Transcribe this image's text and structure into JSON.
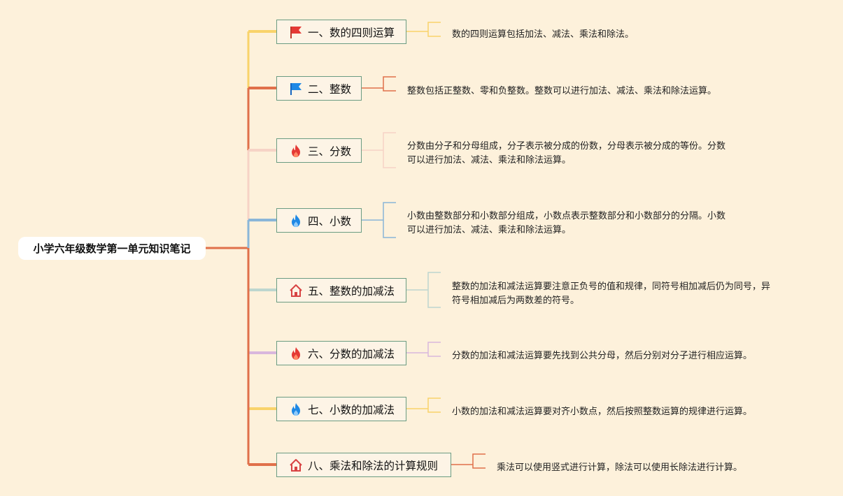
{
  "root": {
    "title": "小学六年级数学第一单元知识笔记"
  },
  "topics": [
    {
      "label": "一、数的四则运算",
      "icon": "red-flag-icon",
      "color": "#f9d36a",
      "note": [
        "数的四则运算包括加法、减法、乘法和除法。"
      ]
    },
    {
      "label": "二、整数",
      "icon": "blue-flag-icon",
      "color": "#e0704a",
      "note": [
        "整数包括正整数、零和负整数。整数可以进行加法、减法、乘法和除法运算。"
      ]
    },
    {
      "label": "三、分数",
      "icon": "fire-icon",
      "color": "#f6d3c6",
      "note": [
        "分数由分子和分母组成，分子表示被分成的份数，分母表示被分成的等份。分数",
        "可以进行加法、减法、乘法和除法运算。"
      ]
    },
    {
      "label": "四、小数",
      "icon": "blue-fire-icon",
      "color": "#8ab6d8",
      "note": [
        "小数由整数部分和小数部分组成，小数点表示整数部分和小数部分的分隔。小数",
        "可以进行加法、减法、乘法和除法运算。"
      ]
    },
    {
      "label": "五、整数的加减法",
      "icon": "house-icon",
      "color": "#bdd6cf",
      "note": [
        "整数的加法和减法运算要注意正负号的值和规律，同符号相加减后仍为同号，异",
        "符号相加减后为两数差的符号。"
      ]
    },
    {
      "label": "六、分数的加减法",
      "icon": "fire-icon",
      "color": "#d9b7dd",
      "note": [
        "分数的加法和减法运算要先找到公共分母，然后分别对分子进行相应运算。"
      ]
    },
    {
      "label": "七、小数的加减法",
      "icon": "blue-fire-icon",
      "color": "#f9d36a",
      "note": [
        "小数的加法和减法运算要对齐小数点，然后按照整数运算的规律进行运算。"
      ]
    },
    {
      "label": "八、乘法和除法的计算规则",
      "icon": "house-icon",
      "color": "#e0704a",
      "note": [
        "乘法可以使用竖式进行计算，除法可以使用长除法进行计算。"
      ]
    }
  ]
}
